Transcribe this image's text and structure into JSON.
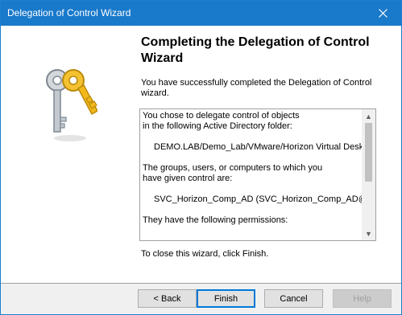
{
  "window": {
    "title": "Delegation of Control Wizard"
  },
  "content": {
    "heading": "Completing the Delegation of Control Wizard",
    "intro": "You have successfully completed the Delegation of Control wizard.",
    "summary_lines": [
      "You chose to delegate control of objects",
      "in the following Active Directory folder:",
      "",
      "DEMO.LAB/Demo_Lab/VMware/Horizon Virtual Desktop",
      "",
      "The groups, users, or computers to which you",
      "have given control are:",
      "",
      "SVC_Horizon_Comp_AD (SVC_Horizon_Comp_AD@DEMO.LAB)",
      "",
      "They have the following permissions:"
    ],
    "closing": "To close this wizard, click Finish."
  },
  "buttons": {
    "back": "< Back",
    "finish": "Finish",
    "cancel": "Cancel",
    "help": "Help"
  },
  "icons": {
    "close": "close-icon",
    "keys": "keys-icon"
  },
  "colors": {
    "titlebar": "#1979ca",
    "accent": "#0078d7"
  }
}
